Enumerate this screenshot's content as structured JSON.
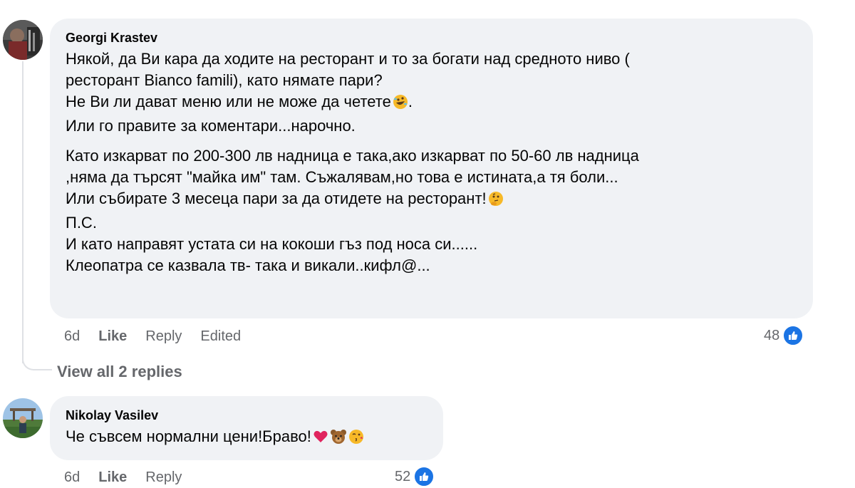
{
  "comments": [
    {
      "author": "Georgi Krastev",
      "lines": [
        "Някой, да Ви кара да ходите на ресторант и то за богати над средното ниво (",
        "ресторант Bianco famili), като нямате пари?",
        "Не Ви ли дават меню или не може да четете",
        "Или го правите за коментари...нарочно."
      ],
      "lines2": [
        "Като изкарват по 200-300 лв надница е така,ако изкарват по 50-60 лв надница",
        ",няма да търсят \"майка им\" там. Съжалявам,но това е истината,а тя боли...",
        "Или събирате 3 месеца пари за да отидете на ресторант!",
        "П.С.",
        "И като направят устата си на кокоши гъз под носа си......",
        "Клеопатра се казвала тв- така и викали..кифл@..."
      ],
      "line_suffix": ".",
      "time": "6d",
      "like_label": "Like",
      "reply_label": "Reply",
      "edited_label": "Edited",
      "reactions_count": "48",
      "emojis": [
        "rofl-emoji",
        "thinking-emoji"
      ]
    },
    {
      "author": "Nikolay Vasilev",
      "text": "Че съвсем нормални цени!Браво!",
      "time": "6d",
      "like_label": "Like",
      "reply_label": "Reply",
      "reactions_count": "52",
      "emojis": [
        "red-heart-emoji",
        "bear-emoji",
        "kiss-face-emoji"
      ]
    }
  ],
  "view_replies_label": "View all 2 replies",
  "colors": {
    "bubble": "#f0f2f5",
    "meta_text": "#65676b",
    "like_blue": "#1b74e4",
    "thread_line": "#dfe1e5"
  }
}
